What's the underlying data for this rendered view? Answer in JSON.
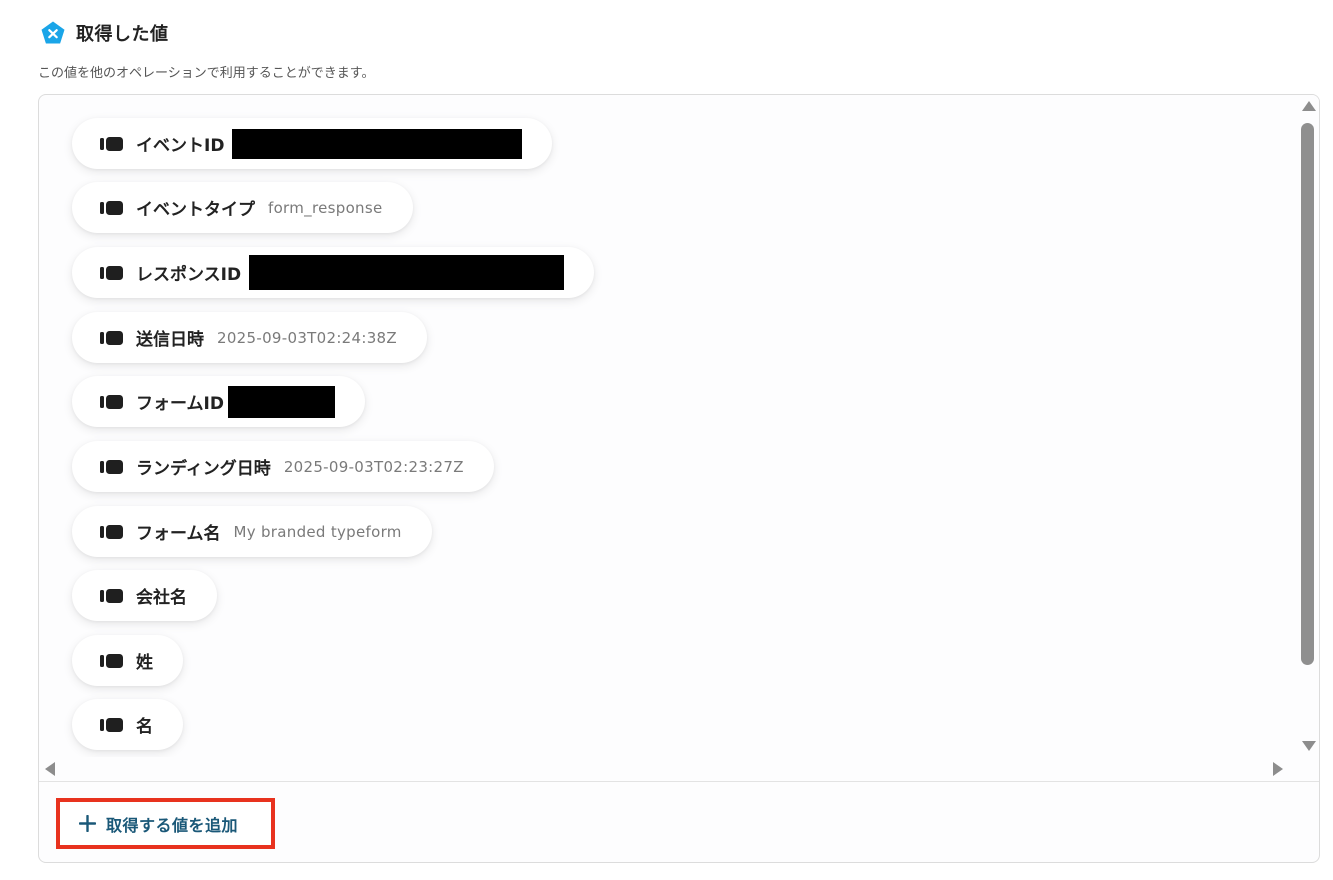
{
  "section": {
    "title": "取得した値",
    "description": "この値を他のオペレーションで利用することができます。"
  },
  "colors": {
    "brand_icon": "#1aa5e8",
    "add_button_text": "#1a5878",
    "highlight_border": "#e8321e"
  },
  "icons": {
    "brand": "pentagon-x-icon",
    "pill_handle": "drag-handle-icon",
    "add": "plus-icon"
  },
  "items": [
    {
      "label": "イベントID",
      "value": "",
      "redacted": true
    },
    {
      "label": "イベントタイプ",
      "value": "form_response",
      "redacted": false
    },
    {
      "label": "レスポンスID",
      "value": "",
      "redacted": true
    },
    {
      "label": "送信日時",
      "value": "2025-09-03T02:24:38Z",
      "redacted": false
    },
    {
      "label": "フォームID",
      "value": "",
      "redacted": true
    },
    {
      "label": "ランディング日時",
      "value": "2025-09-03T02:23:27Z",
      "redacted": false
    },
    {
      "label": "フォーム名",
      "value": "My branded typeform",
      "redacted": false
    },
    {
      "label": "会社名",
      "value": "",
      "redacted": false
    },
    {
      "label": "姓",
      "value": "",
      "redacted": false
    },
    {
      "label": "名",
      "value": "",
      "redacted": false
    }
  ],
  "footer": {
    "add_button_label": "取得する値を追加"
  }
}
